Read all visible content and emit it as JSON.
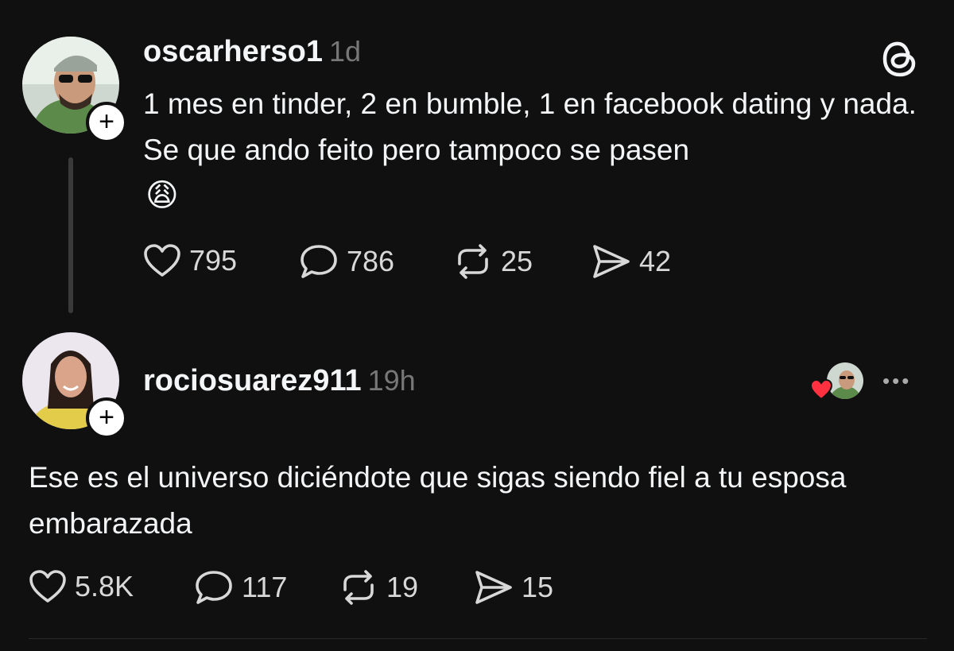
{
  "post": {
    "username": "oscarherso1",
    "time": "1d",
    "text": "1 mes en tinder, 2 en bumble, 1 en facebook dating y nada. Se que ando feito pero tampoco se pasen",
    "emoji": "😩",
    "likes": "795",
    "replies": "786",
    "reposts": "25",
    "shares": "42"
  },
  "reply": {
    "username": "rociosuarez911",
    "time": "19h",
    "text": "Ese es el universo diciéndote que sigas siendo fiel a tu esposa embarazada",
    "likes": "5.8K",
    "replies": "117",
    "reposts": "19",
    "shares": "15"
  },
  "icons": {
    "follow": "+",
    "more": "•••"
  }
}
